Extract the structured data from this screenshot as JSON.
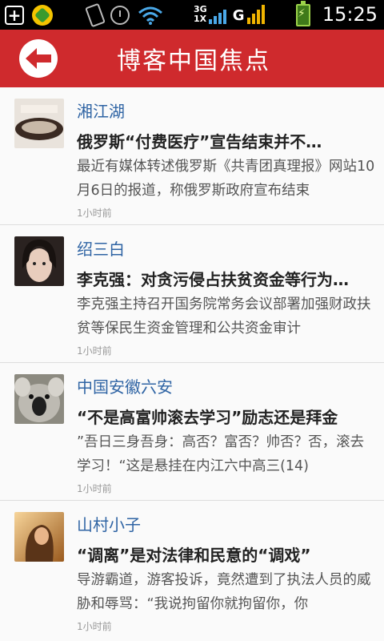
{
  "status_bar": {
    "network": "3G",
    "network2": "1X",
    "carrier_mark": "G",
    "time": "15:25"
  },
  "header": {
    "title": "博客中国焦点"
  },
  "feed": [
    {
      "author": "湘江湖",
      "headline": "俄罗斯“付费医疗”宣告结束并不…",
      "summary": "最近有媒体转述俄罗斯《共青团真理报》网站10月6日的报道，称俄罗斯政府宣布结束",
      "time": "1小时前"
    },
    {
      "author": "绍三白",
      "headline": "李克强：对贪污侵占扶贫资金等行为…",
      "summary": "李克强主持召开国务院常务会议部署加强财政扶贫等保民生资金管理和公共资金审计",
      "time": "1小时前"
    },
    {
      "author": "中国安徽六安",
      "headline": "“不是高富帅滚去学习”励志还是拜金",
      "summary": "”吾日三身吾身：高否？富否？帅否？否，滚去学习！“这是悬挂在内江六中高三(14)",
      "time": "1小时前"
    },
    {
      "author": "山村小子",
      "headline": "“调离”是对法律和民意的“调戏”",
      "summary": "导游霸道，游客投诉，竟然遭到了执法人员的威胁和辱骂：“我说拘留你就拘留你，你",
      "time": "1小时前"
    }
  ]
}
